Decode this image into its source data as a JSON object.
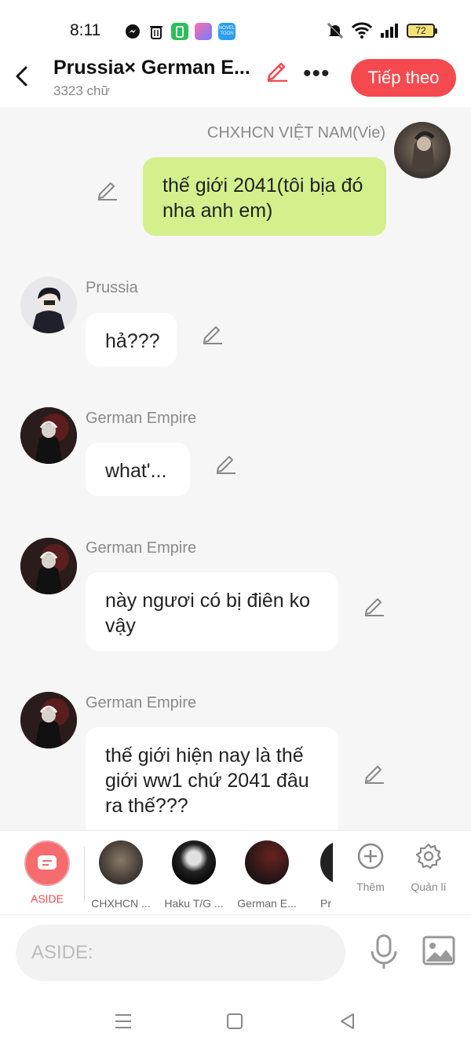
{
  "status": {
    "time": "8:11",
    "battery": "72",
    "app_icons": [
      {
        "name": "messenger-icon",
        "color": "#111"
      },
      {
        "name": "trash-icon",
        "color": "#111"
      },
      {
        "name": "battery-saver-icon",
        "color": "#2bbf5a"
      },
      {
        "name": "app-icon",
        "color": "#7a5cf0"
      },
      {
        "name": "novel-toon-icon",
        "color": "#2a9df4",
        "text": "NOVEL TOON"
      }
    ]
  },
  "header": {
    "title": "Prussia× German E...",
    "word_count": "3323 chữ",
    "next_label": "Tiếp theo",
    "more_label": "•••"
  },
  "messages": [
    {
      "side": "right",
      "name": "CHXHCN VIỆT NAM(Vie)",
      "text": "thế giới 2041(tôi bịa đó nha anh em)"
    },
    {
      "side": "left",
      "name": "Prussia",
      "text": "hả???"
    },
    {
      "side": "left",
      "name": "German Empire",
      "text": "what'..."
    },
    {
      "side": "left",
      "name": "German Empire",
      "text": "này ngươi có bị điên ko vậy"
    },
    {
      "side": "left",
      "name": "German Empire",
      "text": "thế giới hiện nay là thế giới ww1 chứ 2041 đâu ra thế???"
    }
  ],
  "characters": {
    "aside_label": "ASIDE",
    "items": [
      "CHXHCN ...",
      "Haku T/G ...",
      "German E...",
      "Pr"
    ],
    "add_label": "Thêm",
    "manage_label": "Quản lí"
  },
  "input": {
    "placeholder": "ASIDE:"
  },
  "colors": {
    "accent": "#f44a4f",
    "right_bubble": "#d4f08c",
    "left_bubble": "#ffffff",
    "background": "#f6f6f6"
  }
}
